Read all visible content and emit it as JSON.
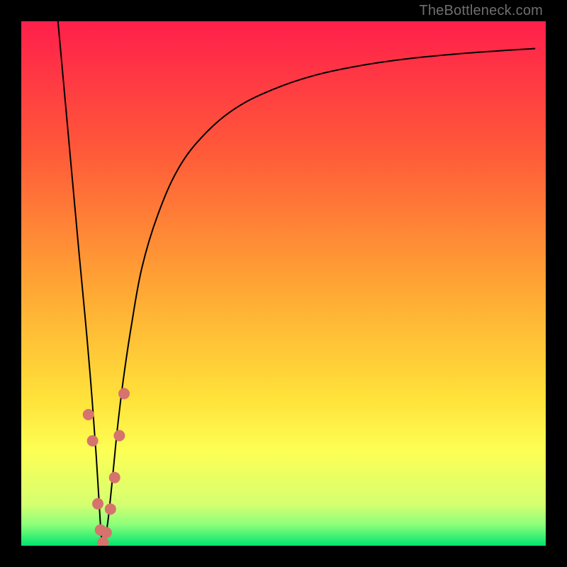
{
  "watermark": "TheBottleneck.com",
  "chart_data": {
    "type": "line",
    "title": "",
    "xlabel": "",
    "ylabel": "",
    "xlim": [
      0,
      100
    ],
    "ylim": [
      0,
      100
    ],
    "grid": false,
    "legend": false,
    "annotations_visible": false,
    "background": {
      "type": "vertical-gradient",
      "stops": [
        {
          "pos": 0.0,
          "color": "#ff1f4b"
        },
        {
          "pos": 0.25,
          "color": "#ff5a39"
        },
        {
          "pos": 0.5,
          "color": "#ffa434"
        },
        {
          "pos": 0.72,
          "color": "#ffe23a"
        },
        {
          "pos": 0.82,
          "color": "#fdff54"
        },
        {
          "pos": 0.92,
          "color": "#d6ff70"
        },
        {
          "pos": 0.96,
          "color": "#8bff7a"
        },
        {
          "pos": 1.0,
          "color": "#00e46e"
        }
      ]
    },
    "series": [
      {
        "name": "bottleneck-curve",
        "color": "#000000",
        "stroke_width": 2,
        "x": [
          7,
          9,
          11,
          12.5,
          13.5,
          14.3,
          14.8,
          15.1,
          15.35,
          15.6,
          16.0,
          16.5,
          17.0,
          17.6,
          18.4,
          19.5,
          21.0,
          23,
          26,
          30,
          35,
          41,
          48,
          56,
          65,
          75,
          86,
          98
        ],
        "y": [
          100,
          78,
          56,
          40,
          28,
          17,
          9,
          4,
          1,
          0.3,
          1.5,
          4.5,
          9,
          15,
          23,
          32,
          42,
          53,
          63,
          72,
          78.5,
          83.5,
          87,
          89.7,
          91.6,
          93,
          94,
          94.8
        ]
      }
    ],
    "markers": {
      "name": "highlighted-points",
      "color": "#d6736d",
      "radius": 8,
      "points": [
        {
          "x": 12.8,
          "y": 25
        },
        {
          "x": 13.6,
          "y": 20
        },
        {
          "x": 14.6,
          "y": 8
        },
        {
          "x": 15.1,
          "y": 3
        },
        {
          "x": 15.6,
          "y": 0.6
        },
        {
          "x": 16.2,
          "y": 2.5
        },
        {
          "x": 17.0,
          "y": 7
        },
        {
          "x": 17.8,
          "y": 13
        },
        {
          "x": 18.7,
          "y": 21
        },
        {
          "x": 19.6,
          "y": 29
        }
      ]
    }
  }
}
